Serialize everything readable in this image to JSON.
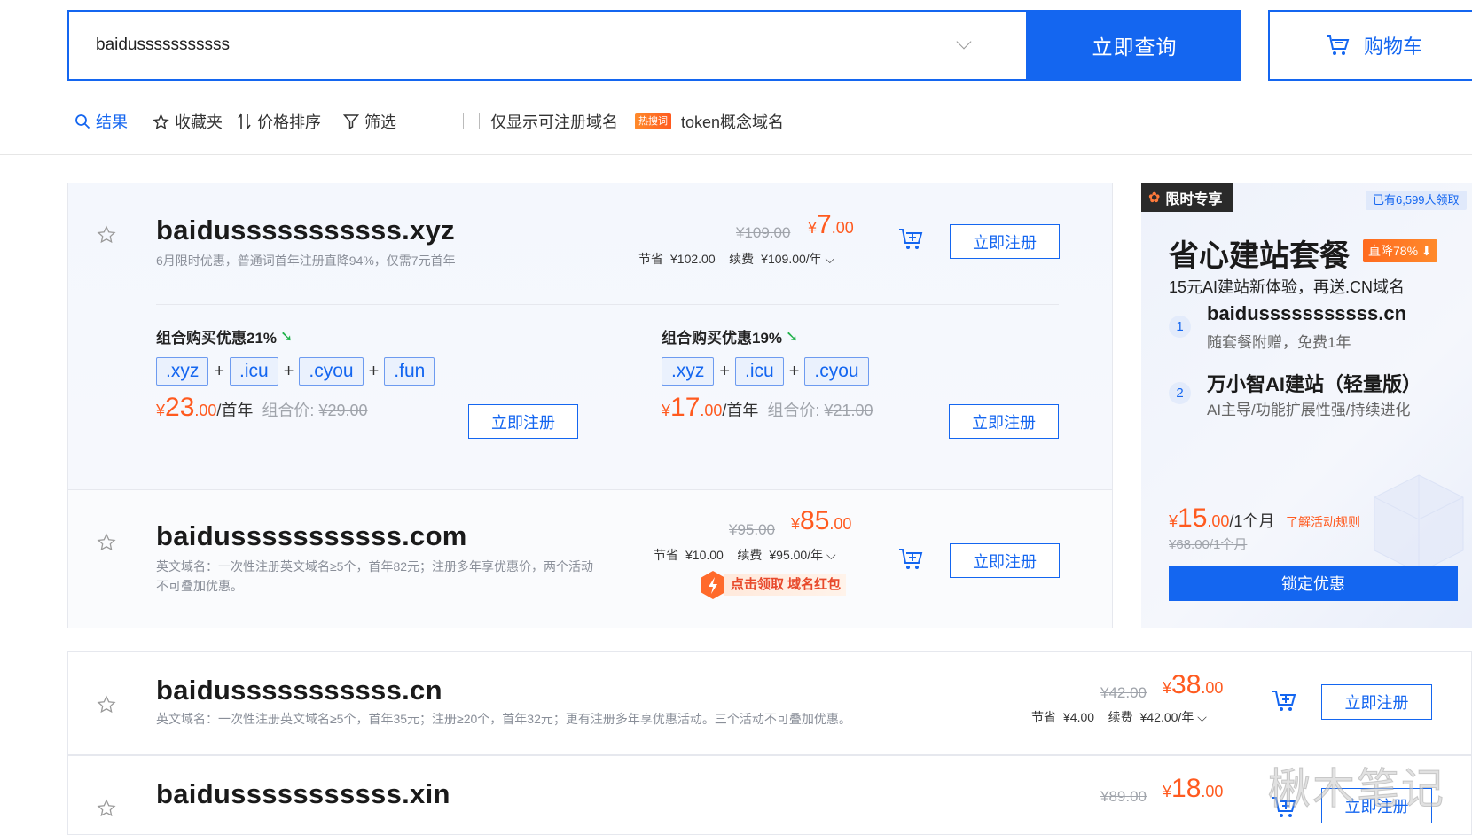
{
  "search": {
    "query": "baidusssssssssss",
    "button_label": "立即查询",
    "cart_label": "购物车"
  },
  "toolbar": {
    "results_label": "结果",
    "favorites_label": "收藏夹",
    "price_sort_label": "价格排序",
    "filter_label": "筛选",
    "only_available_label": "仅显示可注册域名",
    "hot_tag": "热搜词",
    "hot_keyword": "token概念域名"
  },
  "results": [
    {
      "domain": "baidusssssssssss.xyz",
      "desc": "6月限时优惠，普通词首年注册直降94%，仅需7元首年",
      "old_price": "¥109.00",
      "price_symbol": "¥",
      "price_int": "7",
      "price_dec": ".00",
      "save_label": "节省",
      "save_value": "¥102.00",
      "renew_label": "续费",
      "renew_value": "¥109.00/年",
      "register_label": "立即注册"
    },
    {
      "domain": "baidusssssssssss.com",
      "desc": "英文域名：一次性注册英文域名≥5个，首年82元；注册多年享优惠价，两个活动不可叠加优惠。",
      "old_price": "¥95.00",
      "price_symbol": "¥",
      "price_int": "85",
      "price_dec": ".00",
      "save_label": "节省",
      "save_value": "¥10.00",
      "renew_label": "续费",
      "renew_value": "¥95.00/年",
      "register_label": "立即注册",
      "red_packet_label": "点击领取 域名红包"
    },
    {
      "domain": "baidusssssssssss.cn",
      "desc": "英文域名：一次性注册英文域名≥5个，首年35元；注册≥20个，首年32元；更有注册多年享优惠活动。三个活动不可叠加优惠。",
      "old_price": "¥42.00",
      "price_symbol": "¥",
      "price_int": "38",
      "price_dec": ".00",
      "save_label": "节省",
      "save_value": "¥4.00",
      "renew_label": "续费",
      "renew_value": "¥42.00/年",
      "register_label": "立即注册"
    },
    {
      "domain": "baidusssssssssss.xin",
      "old_price": "¥89.00",
      "price_symbol": "¥",
      "price_int": "18",
      "price_dec": ".00",
      "register_label": "立即注册"
    }
  ],
  "combos": [
    {
      "title": "组合购买优惠21%",
      "tlds": [
        ".xyz",
        ".icu",
        ".cyou",
        ".fun"
      ],
      "price_symbol": "¥",
      "price_int": "23",
      "price_dec": ".00",
      "unit": "/首年",
      "orig_label": "组合价:",
      "orig_price": "¥29.00",
      "register_label": "立即注册"
    },
    {
      "title": "组合购买优惠19%",
      "tlds": [
        ".xyz",
        ".icu",
        ".cyou"
      ],
      "price_symbol": "¥",
      "price_int": "17",
      "price_dec": ".00",
      "unit": "/首年",
      "orig_label": "组合价:",
      "orig_price": "¥21.00",
      "register_label": "立即注册"
    }
  ],
  "ad": {
    "tag": "限时专享",
    "count": "已有6,599人领取",
    "title": "省心建站套餐",
    "discount": "直降78%",
    "subtitle": "15元AI建站新体验，再送.CN域名",
    "items": [
      {
        "num": "1",
        "name": "baidusssssssssss.cn",
        "sub": "随套餐附赠，免费1年"
      },
      {
        "num": "2",
        "name": "万小智AI建站（轻量版）",
        "sub": "AI主导/功能扩展性强/持续进化"
      }
    ],
    "price_symbol": "¥",
    "price_int": "15",
    "price_dec": ".00",
    "price_unit": "/1个月",
    "rule_link": "了解活动规则",
    "old_price": "¥68.00/1个月",
    "button": "锁定优惠"
  },
  "watermark": "楸木笔记",
  "colors": {
    "brand_blue": "#1466f0",
    "price_orange": "#ff5a1f",
    "muted_gray": "#a0a4ab"
  }
}
